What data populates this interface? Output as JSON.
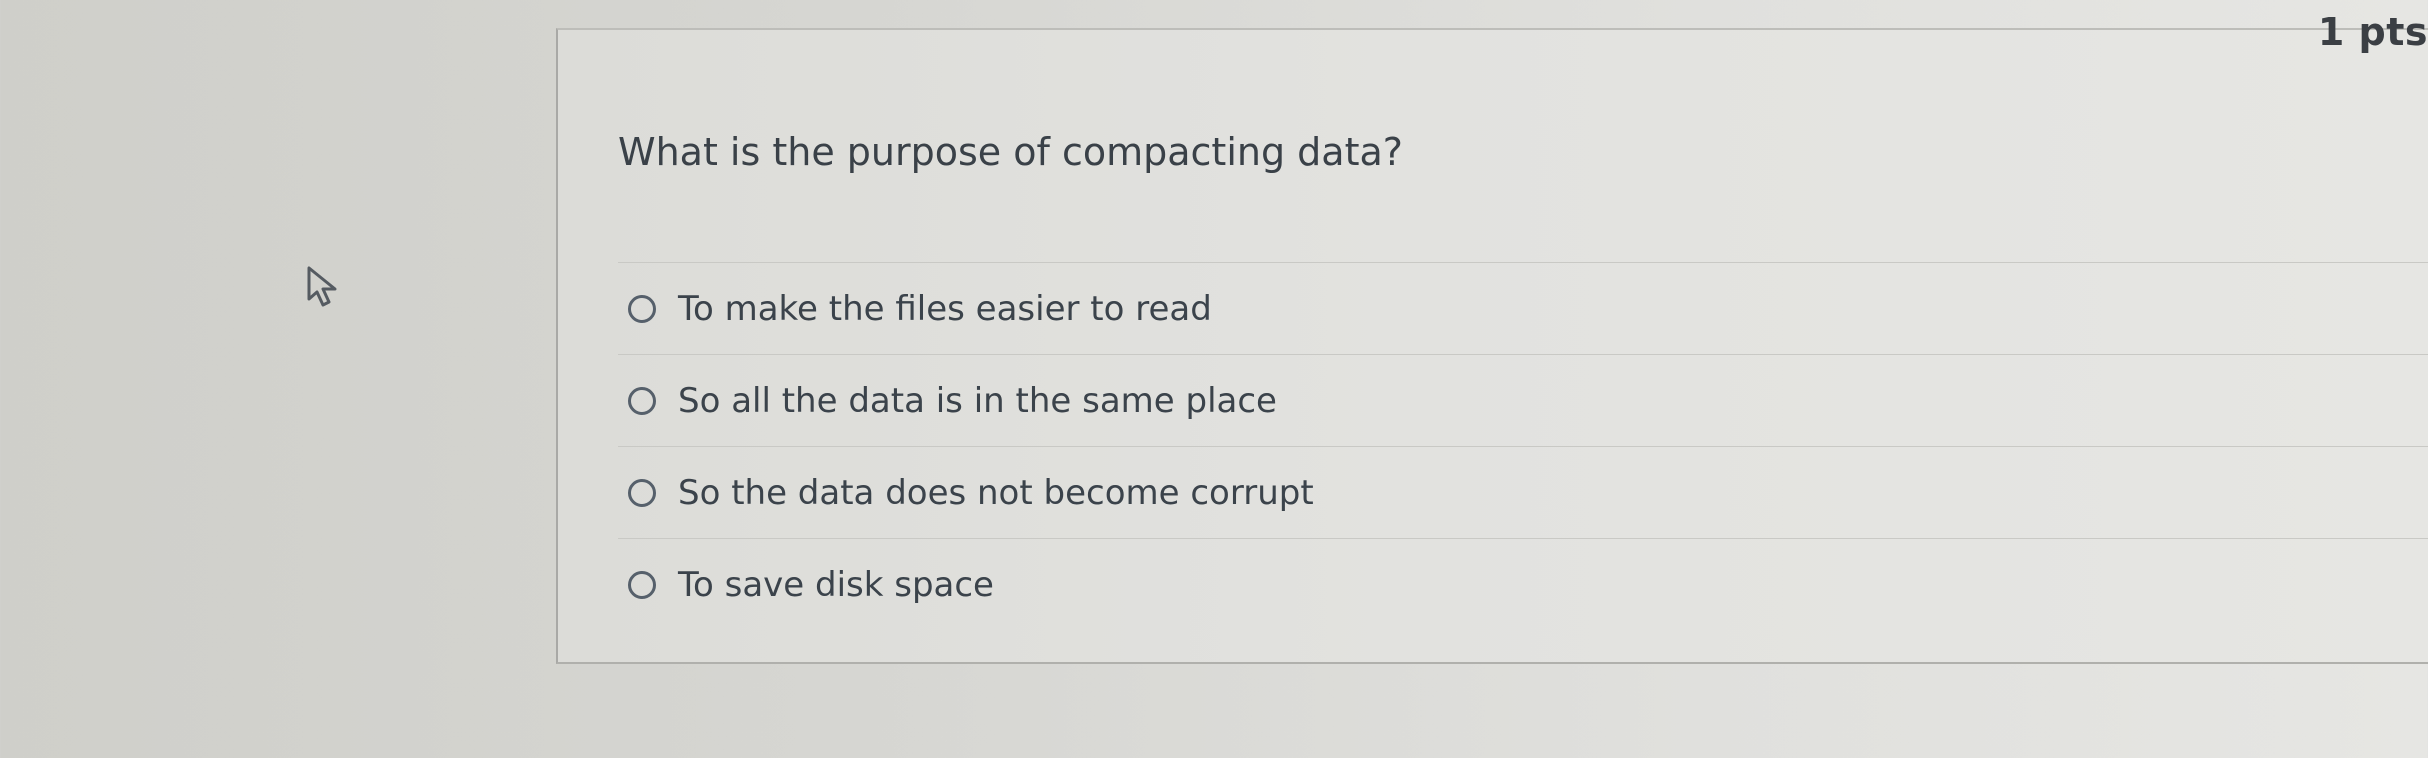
{
  "question": {
    "points": "1 pts",
    "text": "What is the purpose of compacting data?",
    "answers": [
      {
        "label": "To make the files easier to read"
      },
      {
        "label": "So all the data is in the same place"
      },
      {
        "label": "So the data does not become corrupt"
      },
      {
        "label": "To save disk space"
      }
    ]
  },
  "icons": {
    "cursor": "pointer-cursor-icon",
    "radio": "radio-button-icon"
  }
}
